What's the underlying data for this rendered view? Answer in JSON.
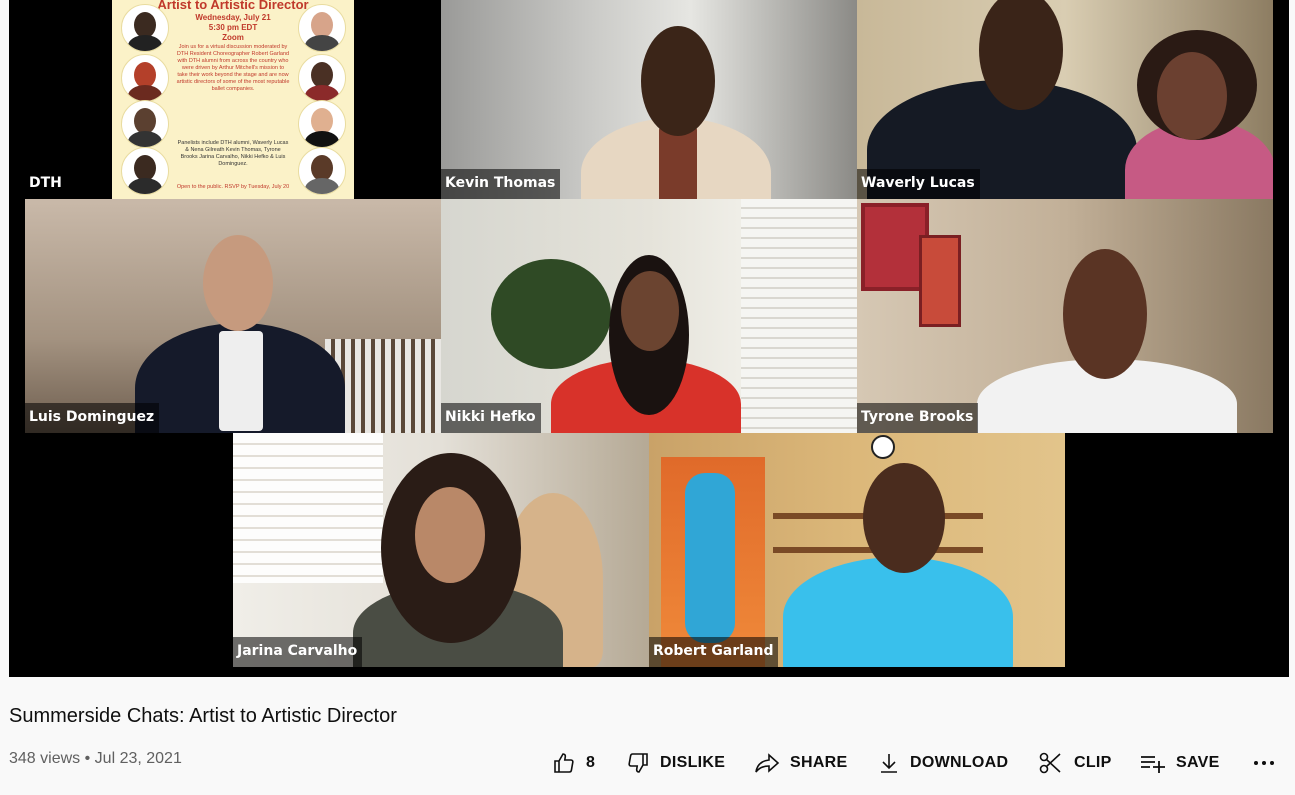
{
  "video": {
    "participants": [
      {
        "name": "DTH"
      },
      {
        "name": "Kevin Thomas"
      },
      {
        "name": "Waverly Lucas"
      },
      {
        "name": "Luis Dominguez"
      },
      {
        "name": "Nikki Hefko"
      },
      {
        "name": "Tyrone Brooks"
      },
      {
        "name": "Jarina Carvalho"
      },
      {
        "name": "Robert Garland"
      }
    ],
    "flyer": {
      "title": "Artist to Artistic Director",
      "date": "Wednesday, July 21",
      "time": "5:30 pm EDT",
      "platform": "Zoom",
      "description": "Join us for a virtual discussion moderated by DTH Resident Choreographer Robert Garland with DTH alumni from across the country who were driven by Arthur Mitchell's mission to take their work beyond the stage and are now artistic directors of some of the most reputable ballet companies.",
      "panelists": "Panelists include DTH alumni, Waverly Lucas & Nena Gilreath Kevin Thomas, Tyrone Brooks Jarina Carvalho, Nikki Hefko & Luis Dominguez.",
      "footer": "Open to the public. RSVP by Tuesday, July 20"
    }
  },
  "meta": {
    "title": "Summerside Chats: Artist to Artistic Director",
    "views": "348 views",
    "separator": "•",
    "date": "Jul 23, 2021"
  },
  "actions": {
    "like_count": "8",
    "dislike": "DISLIKE",
    "share": "SHARE",
    "download": "DOWNLOAD",
    "clip": "CLIP",
    "save": "SAVE"
  },
  "icons": [
    "thumbs-up-icon",
    "thumbs-down-icon",
    "share-icon",
    "download-icon",
    "scissors-icon",
    "playlist-add-icon",
    "more-icon"
  ]
}
